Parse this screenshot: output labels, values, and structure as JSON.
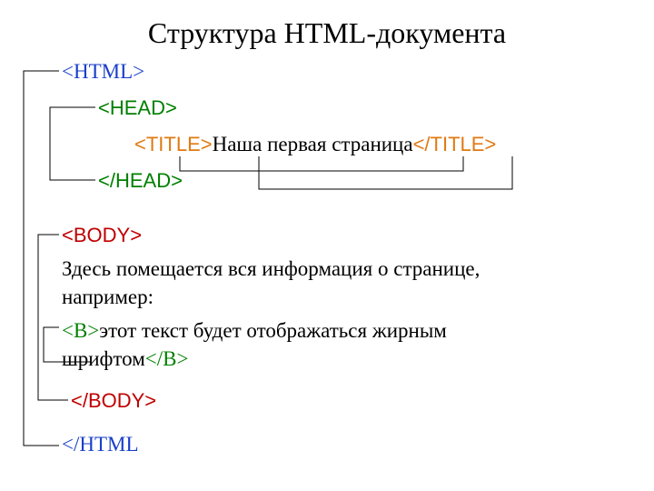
{
  "title": "Структура HTML-документа",
  "tags": {
    "html_open": "<HTML>",
    "head_open": "<HEAD>",
    "title_open": "<TITLE>",
    "title_text": "Наша первая страница",
    "title_close": "</TITLE>",
    "head_close": "</HEAD>",
    "body_open": "<BODY>",
    "body_text_1": "Здесь помещается вся информация о странице, например:",
    "b_open": "<B>",
    "b_text": "этот текст будет отображаться жирным шрифтом",
    "b_close": "</B>",
    "body_close": "</BODY>",
    "html_close": "</HTML"
  }
}
